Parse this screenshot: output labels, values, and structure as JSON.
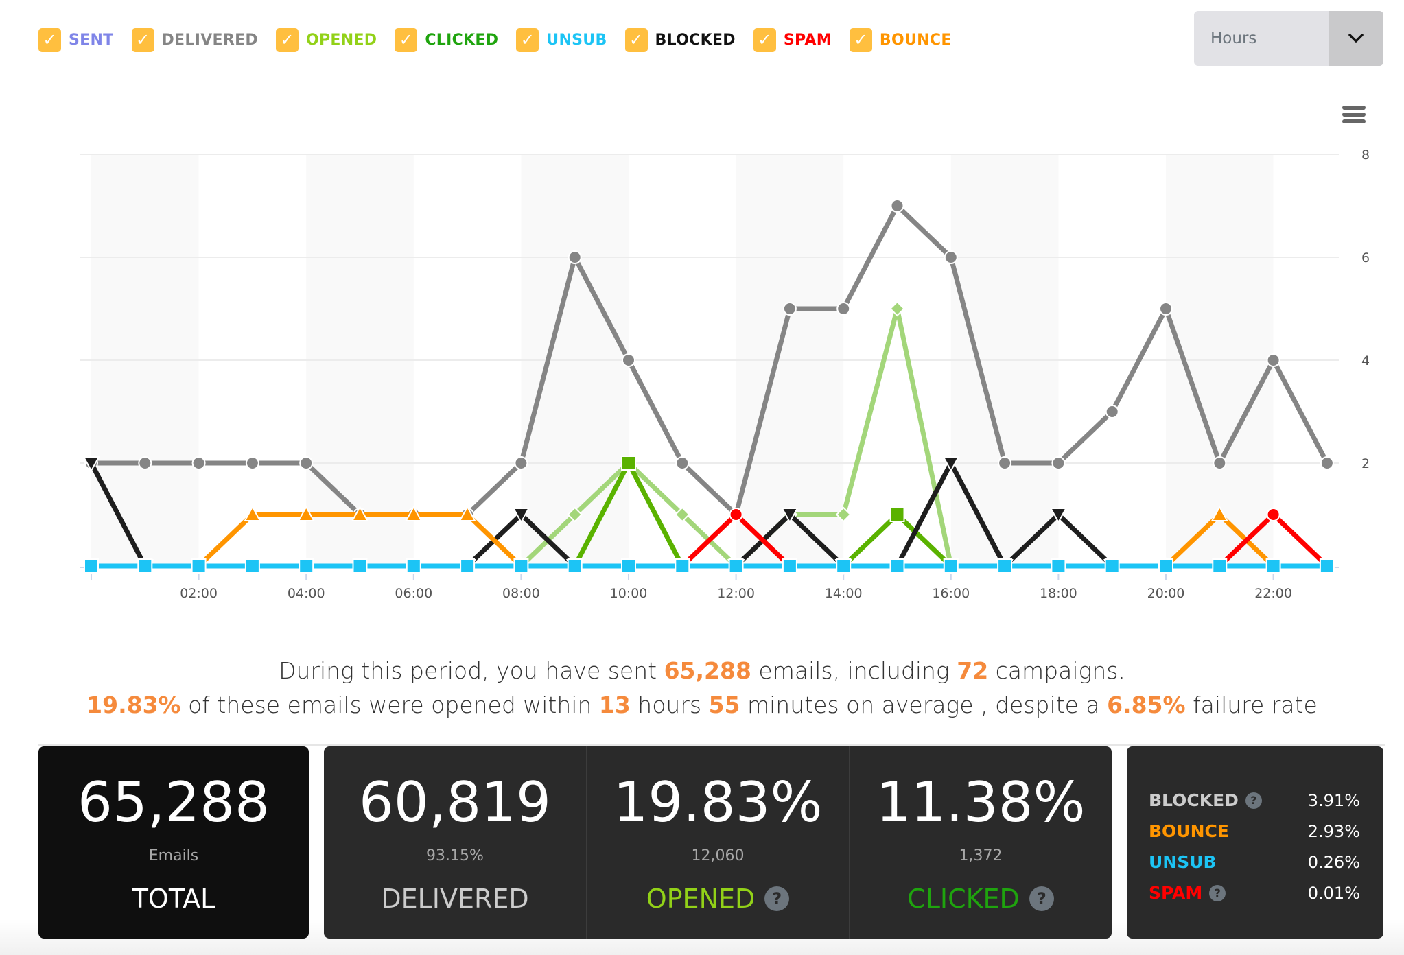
{
  "legend": [
    {
      "key": "sent",
      "label": "SENT",
      "color": "#7f85e8",
      "checked": true
    },
    {
      "key": "delivered",
      "label": "DELIVERED",
      "color": "#858585",
      "checked": true
    },
    {
      "key": "opened",
      "label": "OPENED",
      "color": "#92d118",
      "checked": true
    },
    {
      "key": "clicked",
      "label": "CLICKED",
      "color": "#1fa40e",
      "checked": true
    },
    {
      "key": "unsub",
      "label": "UNSUB",
      "color": "#1cc4f5",
      "checked": true
    },
    {
      "key": "blocked",
      "label": "BLOCKED",
      "color": "#111111",
      "checked": true
    },
    {
      "key": "spam",
      "label": "SPAM",
      "color": "#ff0000",
      "checked": true
    },
    {
      "key": "bounce",
      "label": "BOUNCE",
      "color": "#ff9500",
      "checked": true
    }
  ],
  "check_glyph": "✓",
  "dropdown": {
    "value": "Hours",
    "icon": "chevron-down-icon"
  },
  "chart_menu_icon": "hamburger-menu-icon",
  "chart_data": {
    "type": "line",
    "title": "",
    "xlabel": "",
    "ylabel": "",
    "x": [
      "00:00",
      "01:00",
      "02:00",
      "03:00",
      "04:00",
      "05:00",
      "06:00",
      "07:00",
      "08:00",
      "09:00",
      "10:00",
      "11:00",
      "12:00",
      "13:00",
      "14:00",
      "15:00",
      "16:00",
      "17:00",
      "18:00",
      "19:00",
      "20:00",
      "21:00",
      "22:00",
      "23:00"
    ],
    "x_tick_labels": [
      "02:00",
      "04:00",
      "06:00",
      "08:00",
      "10:00",
      "12:00",
      "14:00",
      "16:00",
      "18:00",
      "20:00",
      "22:00"
    ],
    "y_ticks": [
      2,
      4,
      6,
      8
    ],
    "ylim": [
      0,
      8
    ],
    "y_axis_side": "right",
    "grid": true,
    "alternating_bands": true,
    "series": [
      {
        "name": "DELIVERED",
        "color": "#858585",
        "marker": "circle",
        "values": [
          2,
          2,
          2,
          2,
          2,
          1,
          1,
          1,
          2,
          6,
          4,
          2,
          1,
          5,
          5,
          7,
          6,
          2,
          2,
          3,
          5,
          2,
          4,
          2
        ]
      },
      {
        "name": "OPENED",
        "color": "#a3d67a",
        "marker": "diamond",
        "values": [
          null,
          null,
          null,
          null,
          null,
          null,
          null,
          null,
          0,
          1,
          2,
          1,
          0,
          1,
          1,
          5,
          0,
          null,
          null,
          null,
          null,
          null,
          null,
          null
        ]
      },
      {
        "name": "CLICKED",
        "color": "#5ab200",
        "marker": "square",
        "values": [
          null,
          null,
          null,
          null,
          null,
          null,
          null,
          null,
          null,
          0,
          2,
          0,
          null,
          null,
          0,
          1,
          0,
          null,
          null,
          null,
          null,
          null,
          null,
          null
        ]
      },
      {
        "name": "BLOCKED",
        "color": "#1e1e1e",
        "marker": "triangle-down",
        "values": [
          2,
          0,
          null,
          null,
          null,
          null,
          null,
          0,
          1,
          0,
          null,
          null,
          0,
          1,
          0,
          0,
          2,
          0,
          1,
          0,
          null,
          null,
          null,
          null
        ]
      },
      {
        "name": "BOUNCE",
        "color": "#ff9500",
        "marker": "triangle",
        "values": [
          null,
          null,
          0,
          1,
          1,
          1,
          1,
          1,
          0,
          null,
          null,
          null,
          null,
          null,
          null,
          null,
          null,
          null,
          null,
          null,
          0,
          1,
          0,
          null
        ]
      },
      {
        "name": "SPAM",
        "color": "#ff0000",
        "marker": "circle",
        "values": [
          null,
          null,
          null,
          null,
          null,
          null,
          null,
          null,
          null,
          null,
          null,
          0,
          1,
          0,
          null,
          null,
          null,
          null,
          null,
          null,
          null,
          0,
          1,
          0
        ]
      },
      {
        "name": "UNSUB",
        "color": "#1cc4f5",
        "marker": "square",
        "values": [
          0,
          0,
          0,
          0,
          0,
          0,
          0,
          0,
          0,
          0,
          0,
          0,
          0,
          0,
          0,
          0,
          0,
          0,
          0,
          0,
          0,
          0,
          0,
          0
        ]
      }
    ]
  },
  "summary": {
    "l1_a": "During this period, you have sent ",
    "l1_sent": "65,288",
    "l1_b": " emails, including ",
    "l1_campaigns": "72",
    "l1_c": " campaigns.",
    "l2_open_rate": "19.83%",
    "l2_a": " of these emails were opened within ",
    "l2_hours": "13",
    "l2_b": " hours ",
    "l2_minutes": "55",
    "l2_c": " minutes on average , despite a ",
    "l2_failure": "6.85%",
    "l2_d": " failure rate"
  },
  "cards": {
    "total": {
      "value": "65,288",
      "sub": "Emails",
      "label": "TOTAL",
      "label_color": "#ffffff"
    },
    "delivered": {
      "value": "60,819",
      "sub": "93.15%",
      "label": "DELIVERED",
      "label_color": "#cccccc"
    },
    "opened": {
      "value": "19.83%",
      "sub": "12,060",
      "label": "OPENED",
      "label_color": "#92d118",
      "help": "?"
    },
    "clicked": {
      "value": "11.38%",
      "sub": "1,372",
      "label": "CLICKED",
      "label_color": "#1fa40e",
      "help": "?"
    }
  },
  "failures": [
    {
      "label": "BLOCKED",
      "value": "3.91%",
      "color": "#cccccc",
      "help": "?"
    },
    {
      "label": "BOUNCE",
      "value": "2.93%",
      "color": "#ff9500"
    },
    {
      "label": "UNSUB",
      "value": "0.26%",
      "color": "#1cc4f5"
    },
    {
      "label": "SPAM",
      "value": "0.01%",
      "color": "#ff0000",
      "help": "?"
    }
  ]
}
